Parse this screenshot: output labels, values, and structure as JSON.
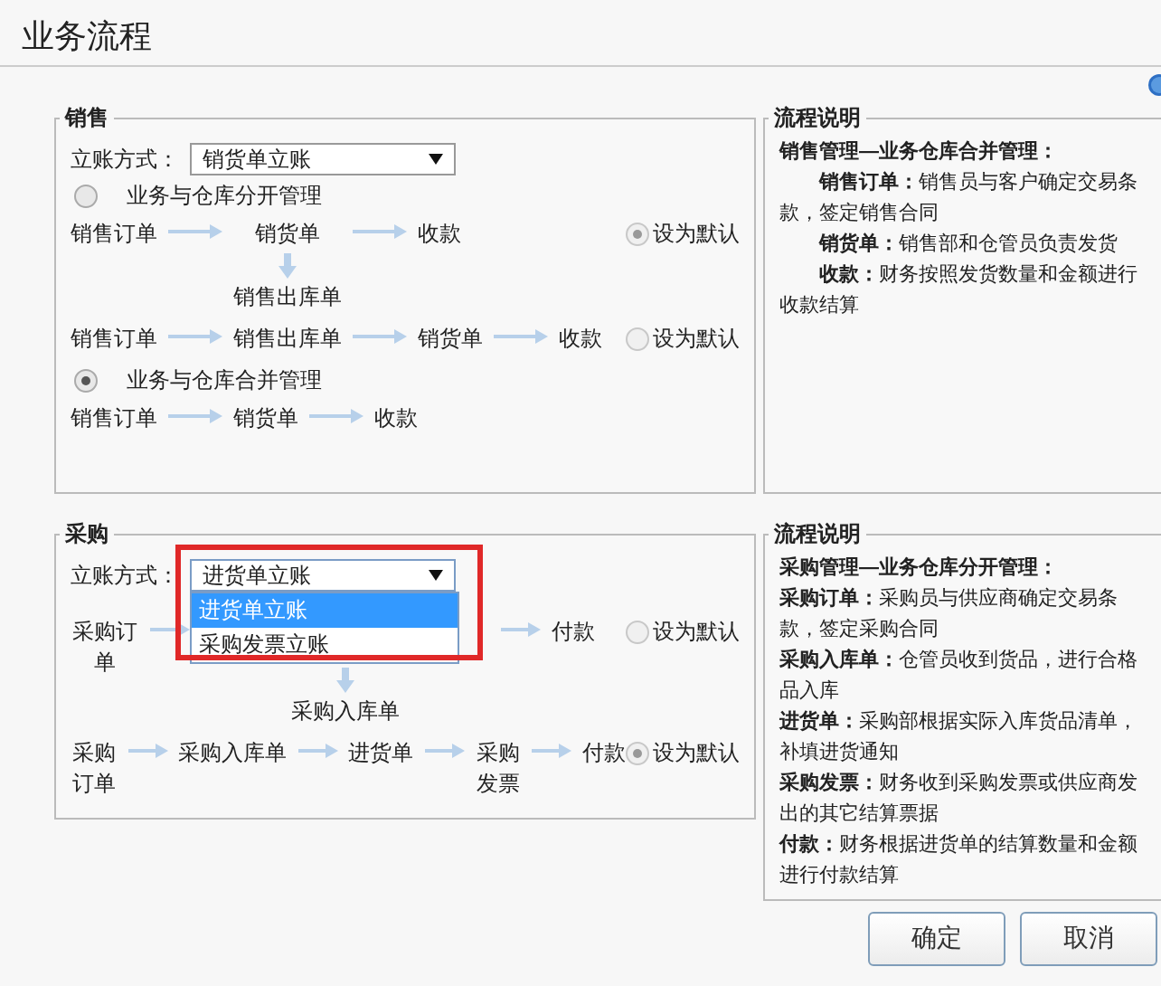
{
  "title": "业务流程",
  "sections": [
    {
      "legend": "销售",
      "account": {
        "label": "立账方式：",
        "value": "销货单立账",
        "open": false
      },
      "groups": [
        {
          "label": "业务与仓库分开管理",
          "selected": false,
          "flows": [
            {
              "steps": [
                {
                  "kind": "step",
                  "label": "销售订单"
                },
                {
                  "kind": "step",
                  "label": "销货单",
                  "branch": "销售出库单"
                },
                {
                  "kind": "step",
                  "label": "收款"
                }
              ],
              "default": {
                "label": "设为默认",
                "selected": true
              }
            },
            {
              "steps": [
                {
                  "kind": "step",
                  "label": "销售订单"
                },
                {
                  "kind": "step",
                  "label": "销售出库单"
                },
                {
                  "kind": "step",
                  "label": "销货单"
                },
                {
                  "kind": "step",
                  "label": "收款"
                }
              ],
              "default": {
                "label": "设为默认",
                "selected": false
              }
            }
          ]
        },
        {
          "label": "业务与仓库合并管理",
          "selected": true,
          "flows": [
            {
              "steps": [
                {
                  "kind": "step",
                  "label": "销售订单"
                },
                {
                  "kind": "step",
                  "label": "销货单"
                },
                {
                  "kind": "step",
                  "label": "收款"
                }
              ]
            }
          ]
        }
      ]
    },
    {
      "legend": "采购",
      "account": {
        "label": "立账方式：",
        "value": "进货单立账",
        "open": true,
        "highlighted": true,
        "options": [
          {
            "label": "进货单立账",
            "selected": true
          },
          {
            "label": "采购发票立账",
            "selected": false
          }
        ]
      },
      "groups": [
        {
          "flows": [
            {
              "steps": [
                {
                  "kind": "step",
                  "label": "采购订单"
                },
                {
                  "kind": "covered",
                  "branch": "采购入库单"
                },
                {
                  "kind": "step",
                  "label": "付款"
                }
              ],
              "default": {
                "label": "设为默认",
                "selected": false
              }
            },
            {
              "steps": [
                {
                  "kind": "step",
                  "label": "采购订单"
                },
                {
                  "kind": "step",
                  "label": "采购入库单"
                },
                {
                  "kind": "step",
                  "label": "进货单"
                },
                {
                  "kind": "step",
                  "label": "采购发票"
                },
                {
                  "kind": "step",
                  "label": "付款"
                }
              ],
              "default": {
                "label": "设为默认",
                "selected": true
              }
            }
          ]
        }
      ]
    }
  ],
  "descriptions": [
    {
      "legend": "流程说明",
      "heading": "销售管理—业务仓库合并管理：",
      "indented": true,
      "items": [
        "**销售订单：**销售员与客户确定交易条款，签定销售合同",
        "**销货单：**销售部和仓管员负责发货",
        "**收款：**财务按照发货数量和金额进行收款结算"
      ]
    },
    {
      "legend": "流程说明",
      "heading": "采购管理—业务仓库分开管理：",
      "indented": false,
      "items": [
        "**采购订单：**采购员与供应商确定交易条款，签定采购合同",
        "**采购入库单：**仓管员收到货品，进行合格品入库",
        "**进货单：**采购部根据实际入库货品清单，补填进货通知",
        "**采购发票：**财务收到采购发票或供应商发出的其它结算票据",
        "**付款：**财务根据进货单的结算数量和金额进行付款结算"
      ]
    }
  ],
  "buttons": [
    {
      "label": "确定"
    },
    {
      "label": "取消"
    }
  ]
}
